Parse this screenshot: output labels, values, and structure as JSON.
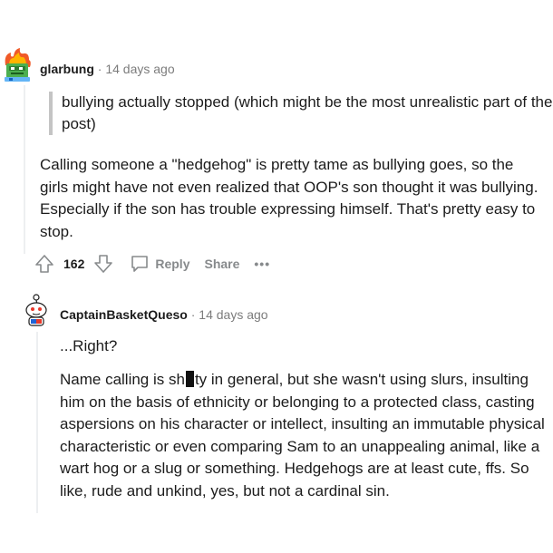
{
  "comment1": {
    "author": "glarbung",
    "separator": "·",
    "time": "14 days ago",
    "quote": "bullying actually stopped (which might be the most unrealistic part of the post)",
    "body": "Calling someone a \"hedgehog\" is pretty tame as bullying goes, so the girls might have not even realized that OOP's son thought it was bullying. Especially if the son has trouble expressing himself. That's pretty easy to stop.",
    "avatar_icon": "fire-robot-avatar-icon"
  },
  "actions": {
    "score": "162",
    "reply_label": "Reply",
    "share_label": "Share",
    "more_label": "•••"
  },
  "comment2": {
    "author": "CaptainBasketQueso",
    "separator": "·",
    "time": "14 days ago",
    "line1": "...Right?",
    "body_before": "Name calling is sh",
    "body_after": "ty in general, but she wasn't using slurs, insulting him on the basis of ethnicity or belonging to a protected class, casting aspersions on his character or intellect, insulting an immutable physical characteristic or even comparing Sam to an unappealing animal, like a wart hog or a slug or something. Hedgehogs are at least cute, ffs. So like, rude and unkind, yes, but not a cardinal sin.",
    "avatar_icon": "snoo-avatar-icon"
  },
  "colors": {
    "meta_gray": "#7c7c7c",
    "action_gray": "#878a8c",
    "quote_bar": "#c4c4c4",
    "thread_line": "#edeff1"
  }
}
